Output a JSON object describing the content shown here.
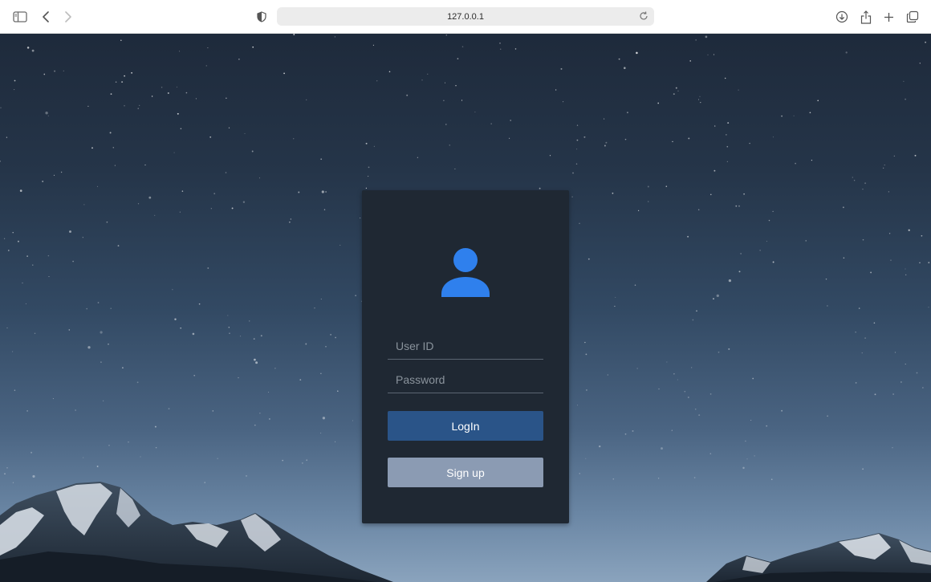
{
  "browser": {
    "url": "127.0.0.1",
    "icons": [
      "sidebar-icon",
      "back-icon",
      "forward-icon",
      "privacy-shield-icon",
      "reload-icon",
      "download-icon",
      "share-icon",
      "new-tab-icon",
      "tabs-overview-icon"
    ]
  },
  "login": {
    "avatar_icon": "user-icon",
    "avatar_color": "#2f80ed",
    "user_id_placeholder": "User ID",
    "password_placeholder": "Password",
    "login_label": "LogIn",
    "signup_label": "Sign up"
  },
  "colors": {
    "card_bg": "#1f2833",
    "login_button": "#2a5488",
    "signup_button": "#8b9bb3"
  }
}
